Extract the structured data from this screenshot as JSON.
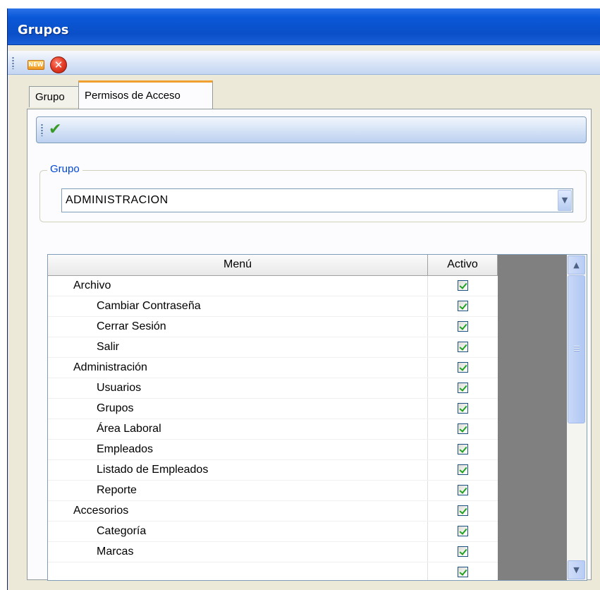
{
  "window": {
    "title": "Grupos"
  },
  "toolbar": {
    "new_label": "NEW"
  },
  "tabs": [
    {
      "label": "Grupo",
      "active": false
    },
    {
      "label": "Permisos de Acceso",
      "active": true
    }
  ],
  "group_box": {
    "legend": "Grupo",
    "selected": "ADMINISTRACION"
  },
  "grid": {
    "headers": {
      "menu": "Menú",
      "active": "Activo"
    },
    "rows": [
      {
        "label": "Archivo",
        "level": 0,
        "active": true
      },
      {
        "label": "Cambiar Contraseña",
        "level": 1,
        "active": true
      },
      {
        "label": "Cerrar Sesión",
        "level": 1,
        "active": true
      },
      {
        "label": "Salir",
        "level": 1,
        "active": true
      },
      {
        "label": "Administración",
        "level": 0,
        "active": true
      },
      {
        "label": "Usuarios",
        "level": 1,
        "active": true
      },
      {
        "label": "Grupos",
        "level": 1,
        "active": true
      },
      {
        "label": "Área Laboral",
        "level": 1,
        "active": true
      },
      {
        "label": "Empleados",
        "level": 1,
        "active": true
      },
      {
        "label": "Listado de Empleados",
        "level": 1,
        "active": true
      },
      {
        "label": "Reporte",
        "level": 1,
        "active": true
      },
      {
        "label": "Accesorios",
        "level": 0,
        "active": true
      },
      {
        "label": "Categoría",
        "level": 1,
        "active": true
      },
      {
        "label": "Marcas",
        "level": 1,
        "active": true
      },
      {
        "label": "",
        "level": 1,
        "active": true
      }
    ]
  },
  "icons": {
    "new": "new-icon",
    "close": "close-icon",
    "save": "checkmark-icon",
    "dropdown": "chevron-down-icon",
    "scroll_up": "chevron-up-icon",
    "scroll_down": "chevron-down-icon"
  },
  "colors": {
    "title_bar": "#0a58d8",
    "legend_text": "#0046d5",
    "checkmark": "#3a9a28",
    "tab_highlight": "#f0a030"
  }
}
